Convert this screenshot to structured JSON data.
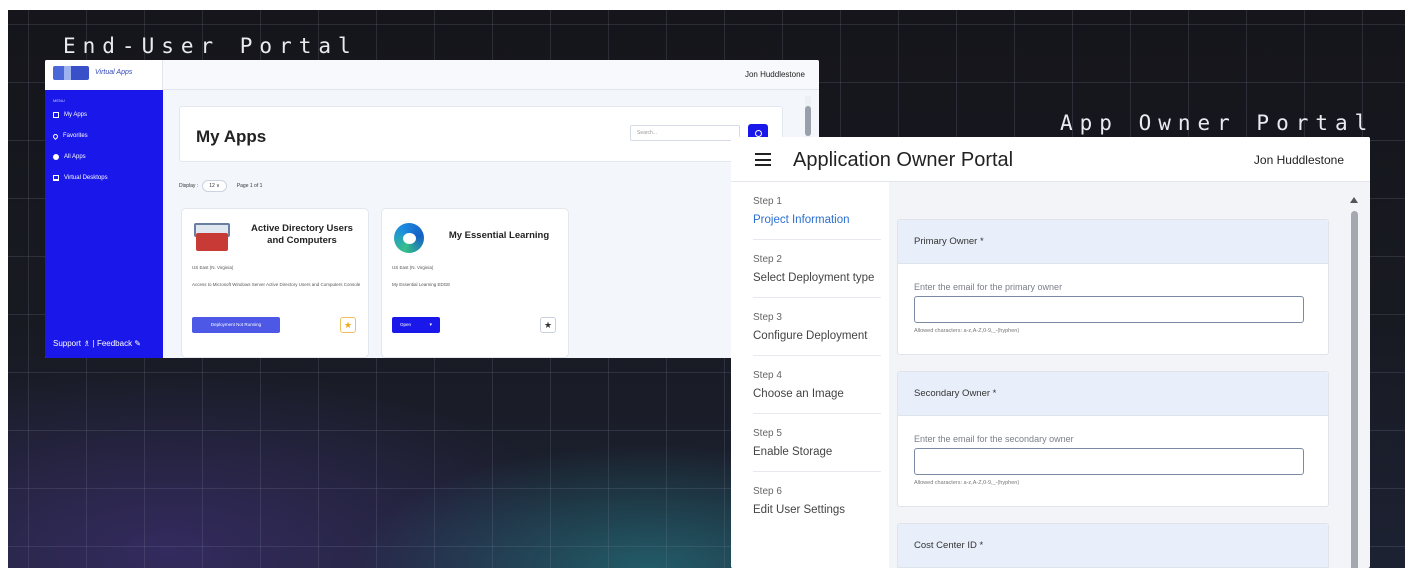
{
  "labels": {
    "end_user": "End-User Portal",
    "app_owner": "App Owner Portal"
  },
  "end_user_portal": {
    "logo_text": "Virtual Apps",
    "user_name": "Jon Huddlestone",
    "menu_caption": "MENU",
    "nav": [
      {
        "label": "My Apps",
        "icon": "monitor-icon"
      },
      {
        "label": "Favorites",
        "icon": "heart-icon"
      },
      {
        "label": "All Apps",
        "icon": "circle-icon"
      },
      {
        "label": "Virtual Desktops",
        "icon": "desktop-icon"
      }
    ],
    "footer": "Support ♗ | Feedback ✎",
    "page_title": "My Apps",
    "search_placeholder": "Search...",
    "display_label": "Display :",
    "display_value": "12 ∨",
    "page_info": "Page 1 of 1",
    "apps": [
      {
        "title": "Active Directory Users and Computers",
        "region": "US East (N. Virginia)",
        "description": "Access to Microsoft Windows Server Active Directory Users and Computers Console",
        "button": "Deployment Not Running",
        "favorite": "★"
      },
      {
        "title": "My Essential Learning",
        "region": "US East (N. Virginia)",
        "description": "My Essential Learning EDGE",
        "button": "Open",
        "favorite": "★"
      }
    ]
  },
  "app_owner_portal": {
    "title": "Application Owner Portal",
    "user_name": "Jon Huddlestone",
    "steps": [
      {
        "number": "Step 1",
        "name": "Project Information",
        "active": true
      },
      {
        "number": "Step 2",
        "name": "Select Deployment type"
      },
      {
        "number": "Step 3",
        "name": "Configure Deployment"
      },
      {
        "number": "Step 4",
        "name": "Choose an Image"
      },
      {
        "number": "Step 5",
        "name": "Enable Storage"
      },
      {
        "number": "Step 6",
        "name": "Edit User Settings"
      }
    ],
    "sections": [
      {
        "heading": "Primary Owner *",
        "hint": "Enter the email for the primary owner",
        "value": "",
        "allowed": "Allowed characters: a-z,A-Z,0-9,_-(hyphen)"
      },
      {
        "heading": "Secondary Owner *",
        "hint": "Enter the email for the secondary owner",
        "value": "",
        "allowed": "Allowed characters: a-z,A-Z,0-9,_-(hyphen)"
      },
      {
        "heading": "Cost Center ID *"
      }
    ]
  },
  "colors": {
    "sidebar_blue": "#1a17ea",
    "active_step": "#2b6fd1",
    "section_head": "#e9effa"
  }
}
